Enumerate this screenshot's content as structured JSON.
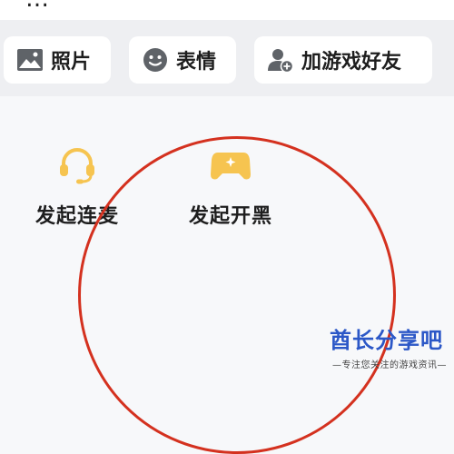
{
  "top": {
    "cut_text": "…"
  },
  "toolbar": {
    "photos_label": "照片",
    "emoji_label": "表情",
    "add_friend_label": "加游戏好友"
  },
  "actions": {
    "voice_label": "发起连麦",
    "game_label": "发起开黑"
  },
  "watermark": {
    "main": "酋长分享吧",
    "sub": "—专注您关注的游戏资讯—"
  },
  "colors": {
    "accent_yellow": "#f6c450",
    "annotation_red": "#d4311f",
    "watermark_blue": "#2b57c7"
  }
}
